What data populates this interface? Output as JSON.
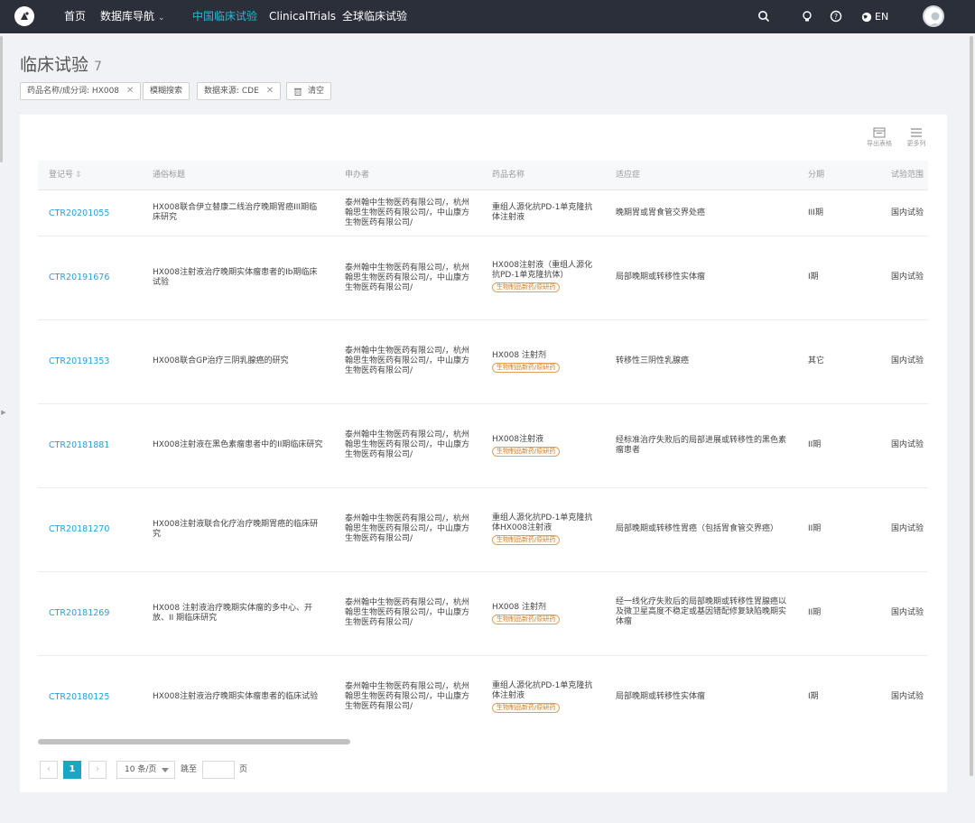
{
  "nav": {
    "home": "首页",
    "database": "数据库导航",
    "china_trials": "中国临床试验",
    "clinicaltrials": "ClinicalTrials",
    "global_trials": "全球临床试验",
    "lang": "EN"
  },
  "header": {
    "title": "临床试验",
    "count": "7"
  },
  "filters": {
    "drug": "药品名称/成分词: HX008",
    "fuzzy": "模糊搜索",
    "source": "数据来源: CDE",
    "clear": "清空"
  },
  "toolbar": {
    "export": "导出表格",
    "more_cols": "更多列"
  },
  "columns": {
    "reg_no": "登记号",
    "title": "通俗标题",
    "sponsor": "申办者",
    "drug": "药品名称",
    "indication": "适应症",
    "phase": "分期",
    "scope": "试验范围"
  },
  "rows": [
    {
      "id": "CTR20201055",
      "title": "HX008联合伊立替康二线治疗晚期胃癌III期临床研究",
      "sponsor": "泰州翰中生物医药有限公司/，杭州翰思生物医药有限公司/，中山康方生物医药有限公司/",
      "drug": "重组人源化抗PD-1单克隆抗体注射液",
      "tag": "",
      "indication": "晚期胃或胃食管交界处癌",
      "phase": "III期",
      "scope": "国内试验"
    },
    {
      "id": "CTR20191676",
      "title": "HX008注射液治疗晚期实体瘤患者的Ib期临床试验",
      "sponsor": "泰州翰中生物医药有限公司/，杭州翰思生物医药有限公司/，中山康方生物医药有限公司/",
      "drug": "HX008注射液（重组人源化抗PD-1单克隆抗体）",
      "tag": "生物制品新药/原研药",
      "indication": "局部晚期或转移性实体瘤",
      "phase": "I期",
      "scope": "国内试验"
    },
    {
      "id": "CTR20191353",
      "title": "HX008联合GP治疗三阴乳腺癌的研究",
      "sponsor": "泰州翰中生物医药有限公司/，杭州翰思生物医药有限公司/，中山康方生物医药有限公司/",
      "drug": "HX008 注射剂",
      "tag": "生物制品新药/原研药",
      "indication": "转移性三阴性乳腺癌",
      "phase": "其它",
      "scope": "国内试验"
    },
    {
      "id": "CTR20181881",
      "title": "HX008注射液在黑色素瘤患者中的II期临床研究",
      "sponsor": "泰州翰中生物医药有限公司/，杭州翰思生物医药有限公司/，中山康方生物医药有限公司/",
      "drug": "HX008注射液",
      "tag": "生物制品新药/原研药",
      "indication": "经标准治疗失败后的局部进展或转移性的黑色素瘤患者",
      "phase": "II期",
      "scope": "国内试验"
    },
    {
      "id": "CTR20181270",
      "title": "HX008注射液联合化疗治疗晚期胃癌的临床研究",
      "sponsor": "泰州翰中生物医药有限公司/，杭州翰思生物医药有限公司/，中山康方生物医药有限公司/",
      "drug": "重组人源化抗PD-1单克隆抗体HX008注射液",
      "tag": "生物制品新药/原研药",
      "indication": "局部晚期或转移性胃癌（包括胃食管交界癌）",
      "phase": "II期",
      "scope": "国内试验"
    },
    {
      "id": "CTR20181269",
      "title": "HX008 注射液治疗晚期实体瘤的多中心、开放、II 期临床研究",
      "sponsor": "泰州翰中生物医药有限公司/，杭州翰思生物医药有限公司/，中山康方生物医药有限公司/",
      "drug": "HX008 注射剂",
      "tag": "生物制品新药/原研药",
      "indication": "经一线化疗失败后的局部晚期或转移性胃腺癌以及微卫星高度不稳定或基因错配修复缺陷晚期实体瘤",
      "phase": "II期",
      "scope": "国内试验"
    },
    {
      "id": "CTR20180125",
      "title": "HX008注射液治疗晚期实体瘤患者的临床试验",
      "sponsor": "泰州翰中生物医药有限公司/，杭州翰思生物医药有限公司/，中山康方生物医药有限公司/",
      "drug": "重组人源化抗PD-1单克隆抗体注射液",
      "tag": "生物制品新药/原研药",
      "indication": "局部晚期或转移性实体瘤",
      "phase": "I期",
      "scope": "国内试验"
    }
  ],
  "pagination": {
    "current": "1",
    "page_size": "10 条/页",
    "goto": "跳至",
    "page": "页"
  }
}
